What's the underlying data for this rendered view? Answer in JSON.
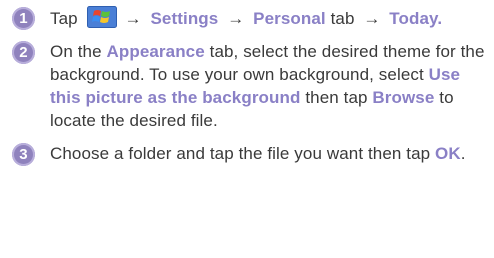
{
  "steps": [
    {
      "number": "1",
      "tap": "Tap",
      "arrow": "→",
      "settings": "Settings",
      "personal": "Personal",
      "tab_word": "tab",
      "today": "Today."
    },
    {
      "number": "2",
      "t1": "On the",
      "appearance": "Appearance",
      "t2": "tab, select the desired theme for the background. To use your own background, select",
      "use_picture": "Use this picture as the background",
      "t3": "then tap",
      "browse": "Browse",
      "t4": "to locate the desired file."
    },
    {
      "number": "3",
      "t1": "Choose a folder and tap the file you want then tap",
      "ok": "OK",
      "t2": "."
    }
  ],
  "icons": {
    "start": "windows-start-flag-icon"
  },
  "colors": {
    "highlight": "#8a80c6",
    "badge": "#8f82bd",
    "text": "#3a3a3a"
  }
}
